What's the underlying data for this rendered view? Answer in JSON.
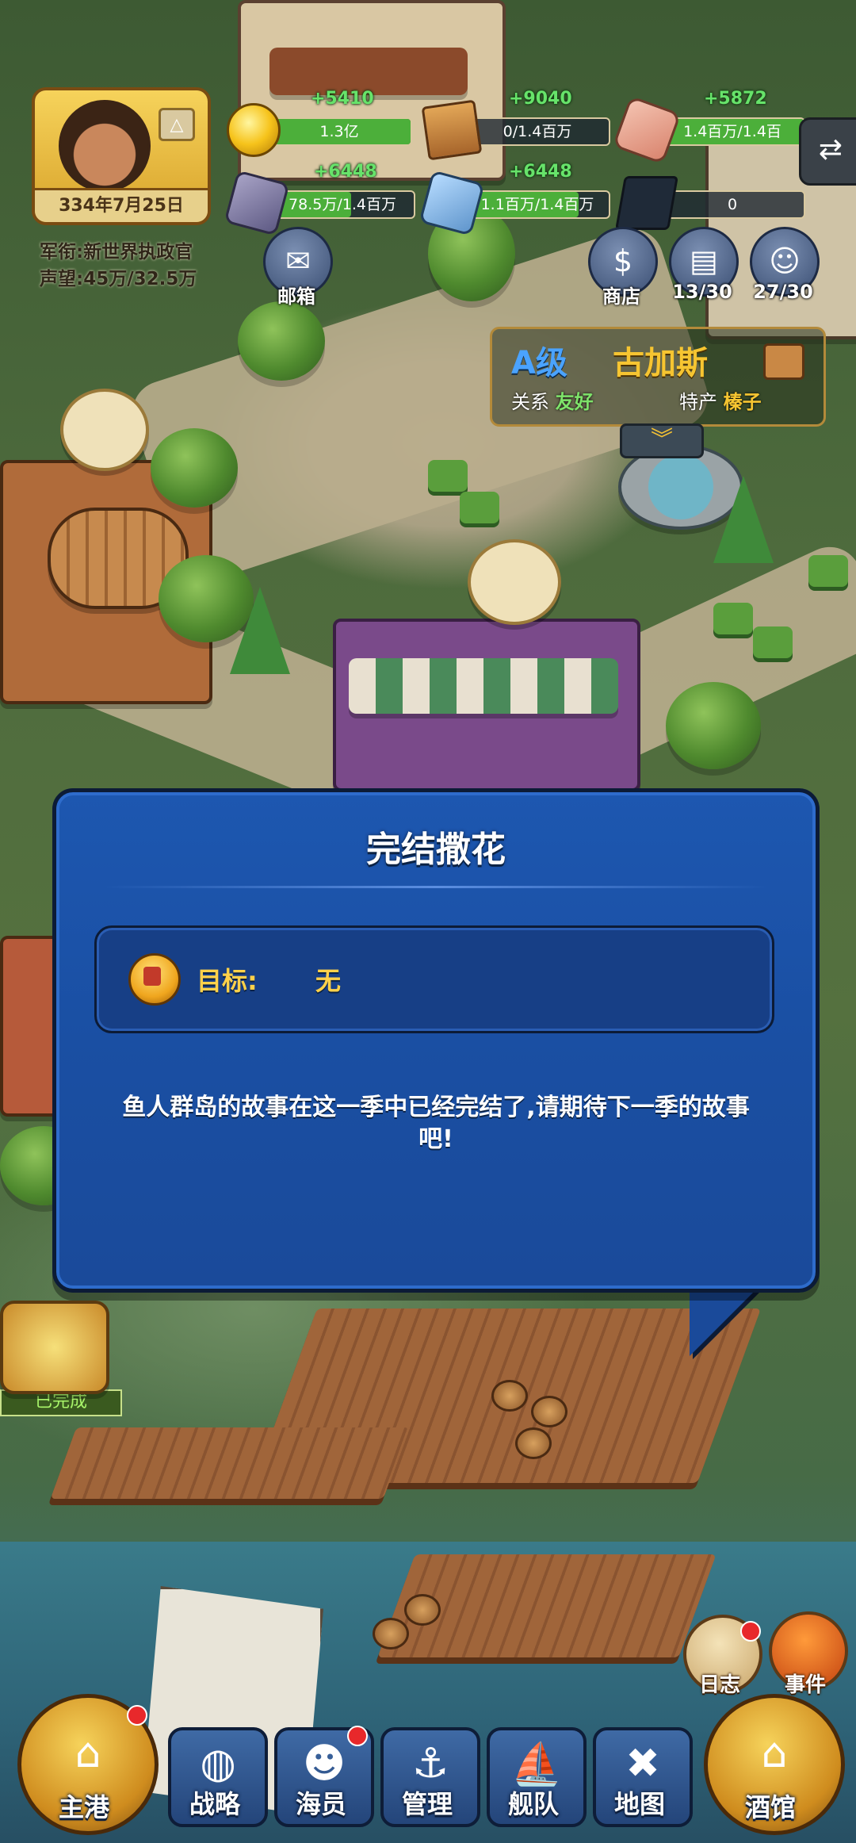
{
  "hud": {
    "date": "334年7月25日",
    "rank_line": "军衔:新世界执政官",
    "fame_line": "声望:45万/32.5万",
    "resources": [
      {
        "icon": "coin-icon",
        "gain": "+5410",
        "value": "1.3亿",
        "fill": 1.0
      },
      {
        "icon": "wood-icon",
        "gain": "+9040",
        "value": "0/1.4百万",
        "fill": 0.0
      },
      {
        "icon": "gem-icon",
        "gain": "+5872",
        "value": "1.4百万/1.4百",
        "fill": 1.0
      },
      {
        "icon": "stone-icon",
        "gain": "+6448",
        "value": "78.5万/1.4百万",
        "fill": 0.56
      },
      {
        "icon": "crystal-icon",
        "gain": "+6448",
        "value": "1.1百万/1.4百万",
        "fill": 0.79
      },
      {
        "icon": "graduation-cap-icon",
        "gain": "",
        "value": "0",
        "fill": 0.0
      }
    ],
    "mail_label": "邮箱",
    "shop_label": "商店",
    "book_label": "13/30",
    "crew_label": "27/30"
  },
  "region": {
    "grade": "A级",
    "name": "古加斯",
    "relation_label": "关系",
    "relation_value": "友好",
    "product_label": "特产",
    "product_value": "榛子"
  },
  "dialog": {
    "title": "完结撒花",
    "goal_label": "目标:",
    "goal_value": "无",
    "body": "鱼人群岛的故事在这一季中已经完结了,请期待下一季的故事吧!"
  },
  "side": {
    "quest_status": "已完成",
    "log_label": "日志",
    "event_label": "事件"
  },
  "nav": {
    "home": "主港",
    "strategy": "战略",
    "crew": "海员",
    "manage": "管理",
    "fleet": "舰队",
    "map": "地图",
    "tavern": "酒馆"
  },
  "colors": {
    "dialog_bg": "#1a4fa3",
    "gold_text": "#ffd14a",
    "gain_green": "#67e36a"
  }
}
